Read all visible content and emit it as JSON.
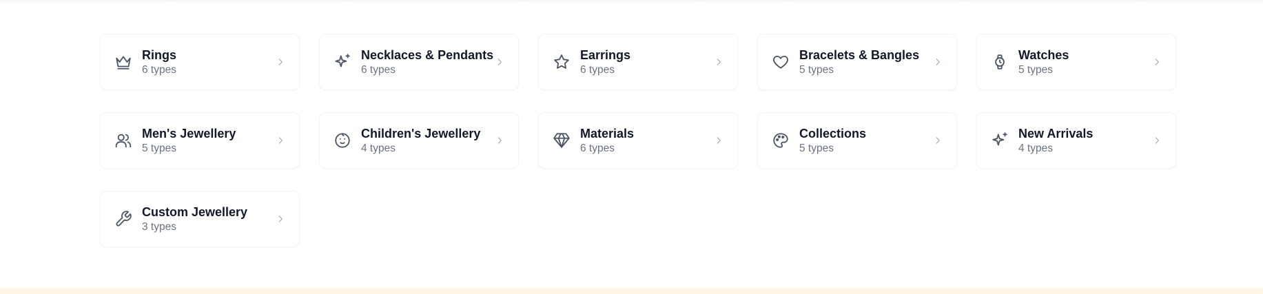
{
  "categories": [
    {
      "name": "Rings",
      "count": "6 types",
      "icon": "crown-icon"
    },
    {
      "name": "Necklaces & Pendants",
      "count": "6 types",
      "icon": "sparkles-icon"
    },
    {
      "name": "Earrings",
      "count": "6 types",
      "icon": "star-icon"
    },
    {
      "name": "Bracelets & Bangles",
      "count": "5 types",
      "icon": "heart-icon"
    },
    {
      "name": "Watches",
      "count": "5 types",
      "icon": "watch-icon"
    },
    {
      "name": "Men's Jewellery",
      "count": "5 types",
      "icon": "users-icon"
    },
    {
      "name": "Children's Jewellery",
      "count": "4 types",
      "icon": "baby-icon"
    },
    {
      "name": "Materials",
      "count": "6 types",
      "icon": "gem-icon"
    },
    {
      "name": "Collections",
      "count": "5 types",
      "icon": "palette-icon"
    },
    {
      "name": "New Arrivals",
      "count": "4 types",
      "icon": "sparkles-icon"
    },
    {
      "name": "Custom Jewellery",
      "count": "3 types",
      "icon": "wrench-icon"
    }
  ],
  "colors": {
    "title": "#111827",
    "subtitle": "#6b7280",
    "icon": "#4b5563",
    "chevron": "#9ca3af",
    "footer_band": "#fef7e6"
  }
}
